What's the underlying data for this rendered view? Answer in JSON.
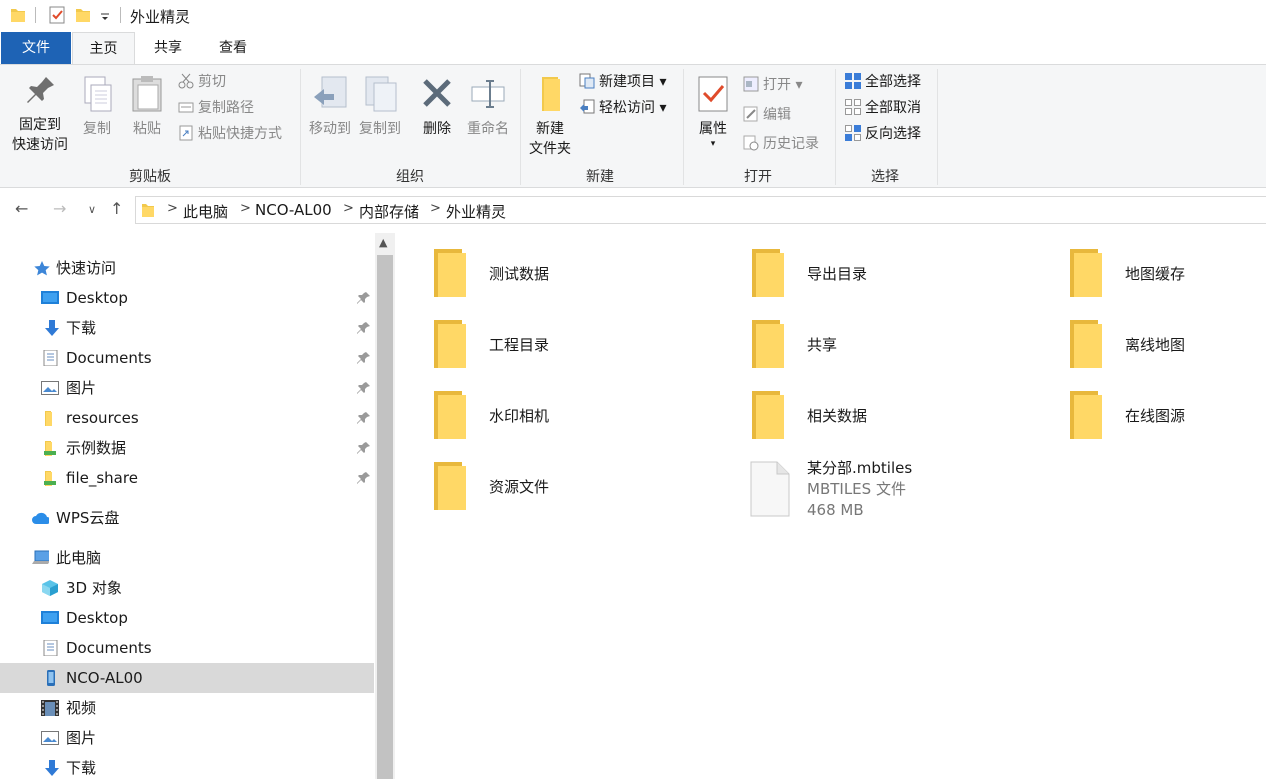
{
  "window": {
    "title": "外业精灵"
  },
  "tabs": [
    {
      "label": "文件"
    },
    {
      "label": "主页"
    },
    {
      "label": "共享"
    },
    {
      "label": "查看"
    }
  ],
  "ribbon": {
    "clipboard": {
      "pin": "固定到\n快速访问",
      "pin_l1": "固定到",
      "pin_l2": "快速访问",
      "copy": "复制",
      "paste": "粘贴",
      "cut": "剪切",
      "copy_path": "复制路径",
      "paste_shortcut": "粘贴快捷方式",
      "label": "剪贴板"
    },
    "organize": {
      "move_to": "移动到",
      "copy_to": "复制到",
      "delete": "删除",
      "rename": "重命名",
      "label": "组织"
    },
    "new": {
      "new_folder_l1": "新建",
      "new_folder_l2": "文件夹",
      "new_item": "新建项目",
      "easy_access": "轻松访问",
      "label": "新建"
    },
    "open": {
      "properties": "属性",
      "open": "打开",
      "edit": "编辑",
      "history": "历史记录",
      "label": "打开"
    },
    "select": {
      "select_all": "全部选择",
      "select_none": "全部取消",
      "invert": "反向选择",
      "label": "选择"
    }
  },
  "address": {
    "crumbs": [
      "此电脑",
      "NCO-AL00",
      "内部存储",
      "外业精灵"
    ]
  },
  "nav": {
    "quick_access": "快速访问",
    "qa_items": [
      "Desktop",
      "下载",
      "Documents",
      "图片",
      "resources",
      "示例数据",
      "file_share"
    ],
    "wps": "WPS云盘",
    "this_pc": "此电脑",
    "pc_items": [
      "3D 对象",
      "Desktop",
      "Documents",
      "NCO-AL00",
      "视频",
      "图片",
      "下载"
    ]
  },
  "content": {
    "folders": [
      "测试数据",
      "导出目录",
      "地图缓存",
      "工程目录",
      "共享",
      "离线地图",
      "水印相机",
      "相关数据",
      "在线图源",
      "资源文件"
    ],
    "file": {
      "name": "某分部.mbtiles",
      "type": "MBTILES 文件",
      "size": "468 MB"
    }
  }
}
